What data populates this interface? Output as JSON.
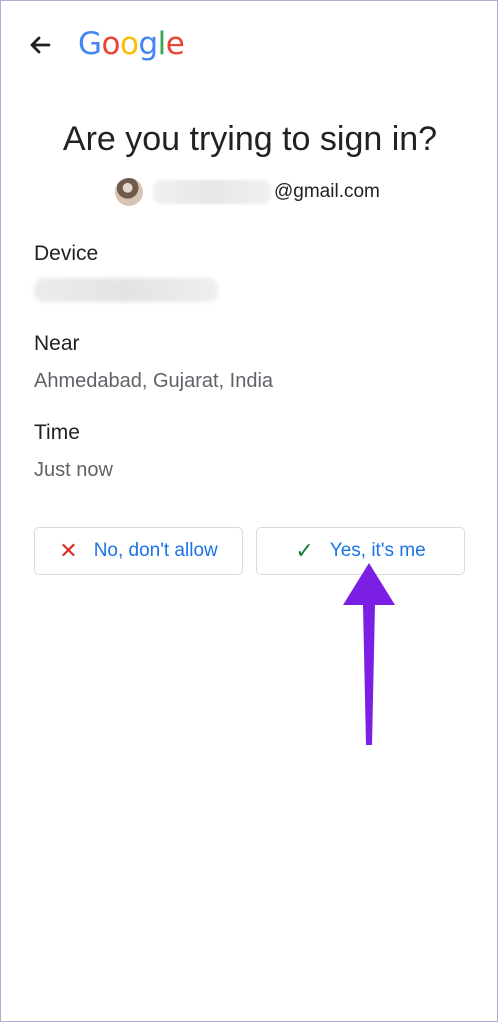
{
  "header": {
    "brand": "Google"
  },
  "title": "Are you trying to sign in?",
  "account": {
    "email_domain": "@gmail.com"
  },
  "device": {
    "label": "Device"
  },
  "near": {
    "label": "Near",
    "value": "Ahmedabad, Gujarat, India"
  },
  "time": {
    "label": "Time",
    "value": "Just now"
  },
  "actions": {
    "deny_label": "No, don't allow",
    "allow_label": "Yes, it's me"
  },
  "colors": {
    "brand_blue": "#4285F4",
    "brand_red": "#EA4335",
    "brand_yellow": "#FBBC05",
    "brand_green": "#34A853",
    "action_blue": "#1a73e8",
    "arrow_purple": "#7b1fe5"
  },
  "icons": {
    "back": "back-arrow-icon",
    "deny": "close-icon",
    "allow": "check-icon",
    "annotation": "pointer-arrow-icon"
  }
}
